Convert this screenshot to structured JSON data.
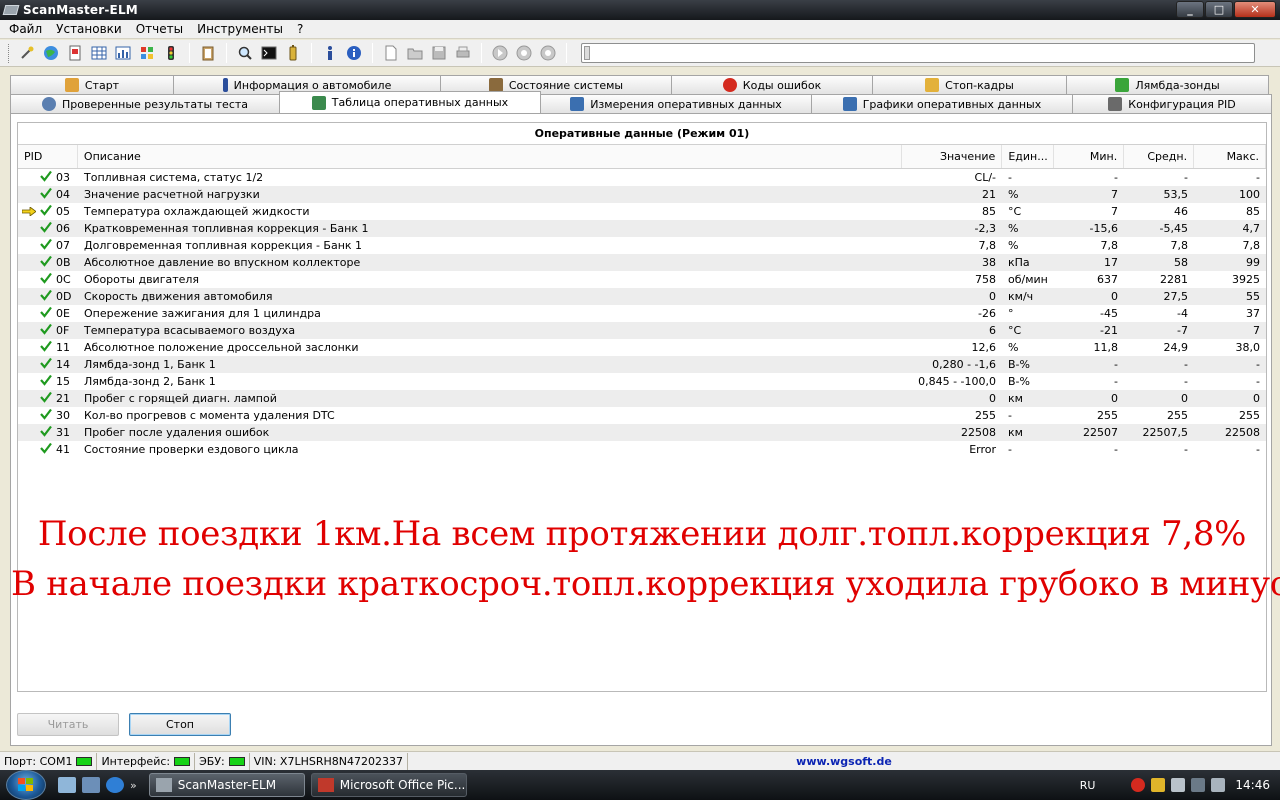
{
  "window": {
    "title": "ScanMaster-ELM",
    "min": "_",
    "max": "□",
    "close": "✕"
  },
  "menu": [
    "Файл",
    "Установки",
    "Отчеты",
    "Инструменты",
    "?"
  ],
  "tabs_row1": [
    {
      "label": "Старт",
      "icon": "hand-icon",
      "color": "#e0a23a"
    },
    {
      "label": "Информация о автомобиле",
      "icon": "info-icon",
      "color": "#2b4e9b"
    },
    {
      "label": "Состояние системы",
      "icon": "clipboard-icon",
      "color": "#8a6a3d"
    },
    {
      "label": "Коды ошибок",
      "icon": "error-icon",
      "color": "#d42a1f"
    },
    {
      "label": "Стоп-кадры",
      "icon": "hand-icon",
      "color": "#e3b13a"
    },
    {
      "label": "Лямбда-зонды",
      "icon": "sensor-icon",
      "color": "#3aa53a"
    }
  ],
  "tabs_row2": [
    {
      "label": "Проверенные результаты теста",
      "icon": "gear-icon",
      "color": "#5b7fb0"
    },
    {
      "label": "Таблица оперативных данных",
      "icon": "table-icon",
      "color": "#3b8a4d"
    },
    {
      "label": "Измерения оперативных данных",
      "icon": "grid-icon",
      "color": "#3b6fb0"
    },
    {
      "label": "Графики оперативных данных",
      "icon": "chart-icon",
      "color": "#3b6fb0"
    },
    {
      "label": "Конфигурация PID",
      "icon": "config-icon",
      "color": "#6a6a6a"
    }
  ],
  "grid": {
    "title": "Оперативные данные (Режим 01)",
    "headers": {
      "pid": "PID",
      "desc": "Описание",
      "value": "Значение",
      "unit": "Един...",
      "min": "Мин.",
      "avg": "Средн.",
      "max": "Макс."
    },
    "rows": [
      {
        "pid": "03",
        "desc": "Топливная система, статус 1/2",
        "value": "CL/-",
        "unit": "-",
        "min": "-",
        "avg": "-",
        "max": "-",
        "marker": false
      },
      {
        "pid": "04",
        "desc": "Значение расчетной нагрузки",
        "value": "21",
        "unit": "%",
        "min": "7",
        "avg": "53,5",
        "max": "100",
        "marker": false
      },
      {
        "pid": "05",
        "desc": "Температура охлаждающей жидкости",
        "value": "85",
        "unit": "°C",
        "min": "7",
        "avg": "46",
        "max": "85",
        "marker": true
      },
      {
        "pid": "06",
        "desc": "Кратковременная топливная коррекция - Банк 1",
        "value": "-2,3",
        "unit": "%",
        "min": "-15,6",
        "avg": "-5,45",
        "max": "4,7",
        "marker": false
      },
      {
        "pid": "07",
        "desc": "Долговременная топливная коррекция - Банк 1",
        "value": "7,8",
        "unit": "%",
        "min": "7,8",
        "avg": "7,8",
        "max": "7,8",
        "marker": false
      },
      {
        "pid": "0B",
        "desc": "Абсолютное давление во впускном коллекторе",
        "value": "38",
        "unit": "кПа",
        "min": "17",
        "avg": "58",
        "max": "99",
        "marker": false
      },
      {
        "pid": "0C",
        "desc": "Обороты двигателя",
        "value": "758",
        "unit": "об/мин",
        "min": "637",
        "avg": "2281",
        "max": "3925",
        "marker": false
      },
      {
        "pid": "0D",
        "desc": "Скорость движения автомобиля",
        "value": "0",
        "unit": "км/ч",
        "min": "0",
        "avg": "27,5",
        "max": "55",
        "marker": false
      },
      {
        "pid": "0E",
        "desc": "Опережение зажигания для 1 цилиндра",
        "value": "-26",
        "unit": "°",
        "min": "-45",
        "avg": "-4",
        "max": "37",
        "marker": false
      },
      {
        "pid": "0F",
        "desc": "Температура  всасываемого воздуха",
        "value": "6",
        "unit": "°C",
        "min": "-21",
        "avg": "-7",
        "max": "7",
        "marker": false
      },
      {
        "pid": "11",
        "desc": "Абсолютное положение дроссельной заслонки",
        "value": "12,6",
        "unit": "%",
        "min": "11,8",
        "avg": "24,9",
        "max": "38,0",
        "marker": false
      },
      {
        "pid": "14",
        "desc": "Лямбда-зонд 1, Банк 1",
        "value": "0,280 - -1,6",
        "unit": "В-%",
        "min": "-",
        "avg": "-",
        "max": "-",
        "marker": false
      },
      {
        "pid": "15",
        "desc": "Лямбда-зонд 2, Банк 1",
        "value": "0,845 - -100,0",
        "unit": "В-%",
        "min": "-",
        "avg": "-",
        "max": "-",
        "marker": false
      },
      {
        "pid": "21",
        "desc": "Пробег с горящей диагн. лампой",
        "value": "0",
        "unit": "км",
        "min": "0",
        "avg": "0",
        "max": "0",
        "marker": false
      },
      {
        "pid": "30",
        "desc": "Кол-во прогревов с момента удаления DTC",
        "value": "255",
        "unit": "-",
        "min": "255",
        "avg": "255",
        "max": "255",
        "marker": false
      },
      {
        "pid": "31",
        "desc": "Пробег после удаления ошибок",
        "value": "22508",
        "unit": "км",
        "min": "22507",
        "avg": "22507,5",
        "max": "22508",
        "marker": false
      },
      {
        "pid": "41",
        "desc": "Состояние проверки ездового цикла",
        "value": "Error",
        "unit": "-",
        "min": "-",
        "avg": "-",
        "max": "-",
        "marker": false
      }
    ]
  },
  "annotation": {
    "line1": "После поездки 1км.На всем протяжении долг.топл.коррекция 7,8%",
    "line2": "В начале поездки краткосроч.топл.коррекция уходила грубоко в минус",
    "color": "#e00000"
  },
  "buttons": {
    "read": "Читать",
    "stop": "Стоп"
  },
  "status": {
    "port_label": "Порт:",
    "port_value": "COM1",
    "interface_label": "Интерфейс:",
    "ecu_label": "ЭБУ:",
    "vin": "VIN: X7LHSRH8N47202337",
    "url": "www.wgsoft.de",
    "led_color": "#16d216"
  },
  "taskbar": {
    "tasks": [
      "ScanMaster-ELM",
      "Microsoft Office Pic..."
    ],
    "quicklaunch_more": "»",
    "lang": "RU",
    "time": "14:46"
  }
}
